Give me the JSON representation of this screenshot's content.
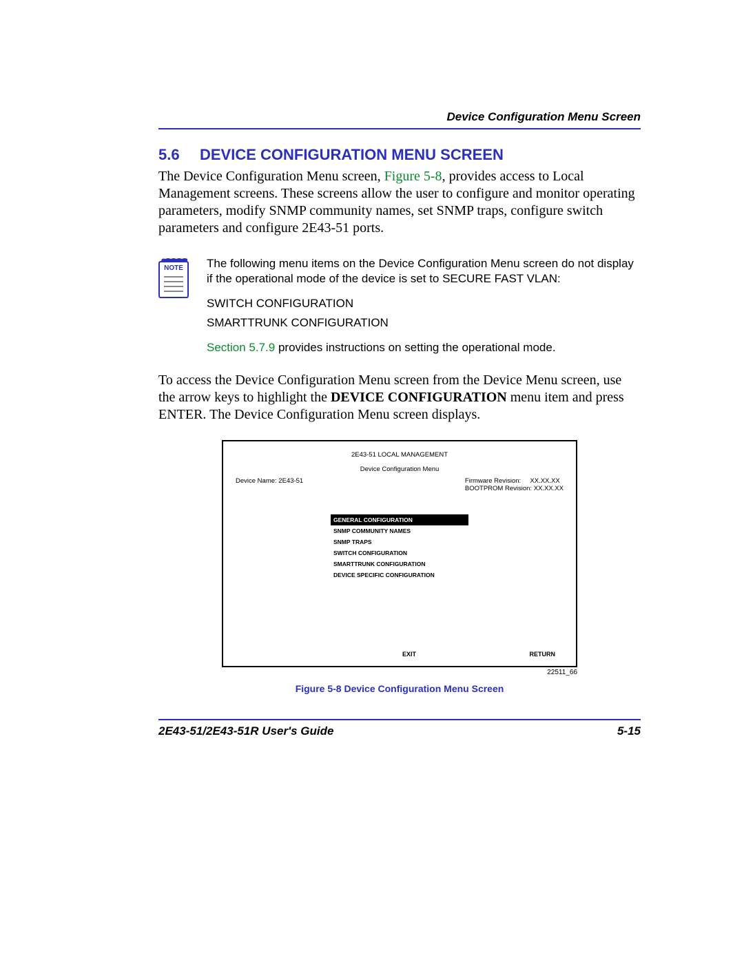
{
  "header": {
    "running_title": "Device Configuration Menu Screen"
  },
  "section": {
    "number": "5.6",
    "title": "DEVICE CONFIGURATION MENU SCREEN"
  },
  "paragraph1": {
    "pre_link": "The Device Configuration Menu screen, ",
    "link": "Figure 5-8",
    "post_link": ", provides access to Local Management screens. These screens allow the user to configure and monitor operating parameters, modify SNMP community names, set SNMP traps, configure switch parameters and configure 2E43-51 ports."
  },
  "note": {
    "badge": "NOTE",
    "line1": "The following menu items on the Device Configuration Menu screen do not display if the operational mode of the device is set to SECURE FAST VLAN:",
    "item1": "SWITCH CONFIGURATION",
    "item2": "SMARTTRUNK CONFIGURATION",
    "ref_link": "Section 5.7.9",
    "ref_rest": " provides instructions on setting the operational mode."
  },
  "paragraph2": {
    "pre_bold": "To access the Device Configuration Menu screen from the Device Menu screen, use the arrow keys to highlight the ",
    "bold": "DEVICE CONFIGURATION",
    "post_bold": " menu item and press ENTER. The Device Configuration Menu screen displays."
  },
  "figure": {
    "title1": "2E43-51 LOCAL MANAGEMENT",
    "title2": "Device Configuration  Menu",
    "device_name_label": "Device Name: 2E43-51",
    "fw_label": "Firmware Revision:",
    "fw_val": "XX.XX.XX",
    "bp_label": "BOOTPROM Revision:",
    "bp_val": "XX.XX.XX",
    "menu": [
      "GENERAL CONFIGURATION",
      "SNMP COMMUNITY NAMES",
      "SNMP TRAPS",
      "SWITCH CONFIGURATION",
      "SMARTTRUNK CONFIGURATION",
      "DEVICE SPECIFIC CONFIGURATION"
    ],
    "exit": "EXIT",
    "ret": "RETURN",
    "id": "22511_66",
    "caption": "Figure 5-8   Device Configuration Menu Screen"
  },
  "footer": {
    "left": "2E43-51/2E43-51R User's Guide",
    "right": "5-15"
  }
}
